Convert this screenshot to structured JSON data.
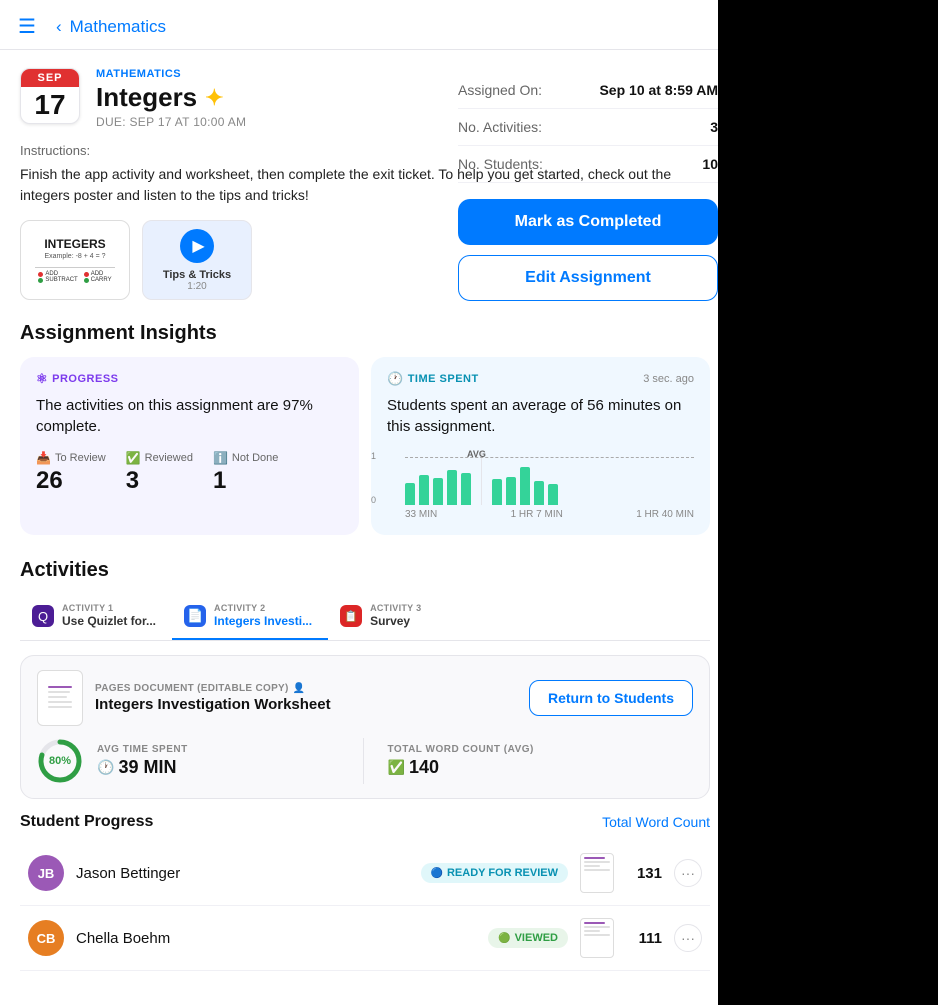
{
  "nav": {
    "back_label": "Mathematics",
    "sidebar_icon": "sidebar",
    "chevron_icon": "chevron-left",
    "icons": [
      "lock-icon",
      "pin-icon",
      "heart-icon",
      "more-icon"
    ]
  },
  "assignment": {
    "month": "SEP",
    "day": "17",
    "subject": "MATHEMATICS",
    "title": "Integers",
    "sparkle": "✦",
    "due": "DUE: SEP 17 AT 10:00 AM",
    "instructions_label": "Instructions:",
    "instructions": "Finish the app activity and worksheet, then complete the exit ticket. To help you get started, check out the integers poster and listen to the tips and tricks!",
    "attachments": [
      {
        "type": "poster",
        "title": "INTEGERS"
      },
      {
        "type": "video",
        "label": "Tips & Tricks",
        "duration": "1:20"
      }
    ]
  },
  "metadata": {
    "assigned_on_label": "Assigned On:",
    "assigned_on_value": "Sep 10 at 8:59 AM",
    "activities_label": "No. Activities:",
    "activities_value": "3",
    "students_label": "No. Students:",
    "students_value": "10"
  },
  "buttons": {
    "mark_completed": "Mark as Completed",
    "edit_assignment": "Edit Assignment"
  },
  "insights": {
    "section_title": "Assignment Insights",
    "progress": {
      "label": "PROGRESS",
      "description": "The activities on this assignment are 97% complete.",
      "stats": [
        {
          "label": "To Review",
          "value": "26",
          "icon": "inbox"
        },
        {
          "label": "Reviewed",
          "value": "3",
          "icon": "checkmark"
        },
        {
          "label": "Not Done",
          "value": "1",
          "icon": "info"
        }
      ]
    },
    "time_spent": {
      "label": "TIME SPENT",
      "timestamp": "3 sec. ago",
      "description": "Students spent an average of 56 minutes on this assignment.",
      "bars": [
        40,
        55,
        50,
        65,
        60,
        48,
        52,
        70,
        45,
        38
      ],
      "avg_label": "AVG",
      "x_labels": [
        "33 MIN",
        "1 HR 7 MIN",
        "1 HR 40 MIN"
      ],
      "y_labels": [
        "1",
        "0"
      ]
    }
  },
  "activities": {
    "section_title": "Activities",
    "tabs": [
      {
        "num": "ACTIVITY 1",
        "label": "Use Quizlet for...",
        "icon": "Q",
        "color": "quizlet"
      },
      {
        "num": "ACTIVITY 2",
        "label": "Integers Investi...",
        "icon": "I",
        "color": "integers",
        "active": true
      },
      {
        "num": "ACTIVITY 3",
        "label": "Survey",
        "icon": "S",
        "color": "survey"
      }
    ],
    "document": {
      "type_label": "PAGES DOCUMENT (EDITABLE COPY)",
      "name": "Integers Investigation Worksheet",
      "return_btn": "Return to Students",
      "progress_pct": 80,
      "avg_time_label": "AVG TIME SPENT",
      "avg_time_value": "39 MIN",
      "word_count_label": "TOTAL WORD COUNT (AVG)",
      "word_count_value": "140"
    }
  },
  "student_progress": {
    "title": "Student Progress",
    "sort_link": "Total Word Count",
    "students": [
      {
        "initials": "JB",
        "name": "Jason Bettinger",
        "status": "READY FOR REVIEW",
        "status_type": "review",
        "word_count": "131"
      },
      {
        "initials": "CB",
        "name": "Chella Boehm",
        "status": "VIEWED",
        "status_type": "viewed",
        "word_count": "111"
      }
    ]
  }
}
